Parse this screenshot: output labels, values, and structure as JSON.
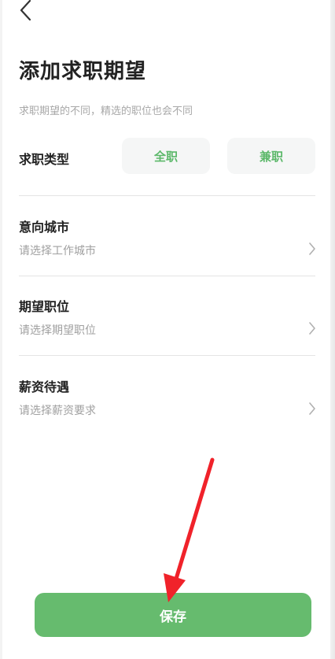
{
  "header": {
    "back_icon": "chevron-left-icon",
    "title": "添加求职期望",
    "subtitle": "求职期望的不同，精选的职位也会不同"
  },
  "job_type": {
    "label": "求职类型",
    "options": [
      "全职",
      "兼职"
    ],
    "accent_color": "#5cb86a"
  },
  "fields": [
    {
      "title": "意向城市",
      "placeholder": "请选择工作城市",
      "icon": "chevron-right-icon"
    },
    {
      "title": "期望职位",
      "placeholder": "请选择期望职位",
      "icon": "chevron-right-icon"
    },
    {
      "title": "薪资待遇",
      "placeholder": "请选择薪资要求",
      "icon": "chevron-right-icon"
    }
  ],
  "save": {
    "label": "保存",
    "color": "#66bb6e"
  },
  "annotation": {
    "arrow_color": "#f0222a",
    "icon": "red-arrow-icon"
  }
}
